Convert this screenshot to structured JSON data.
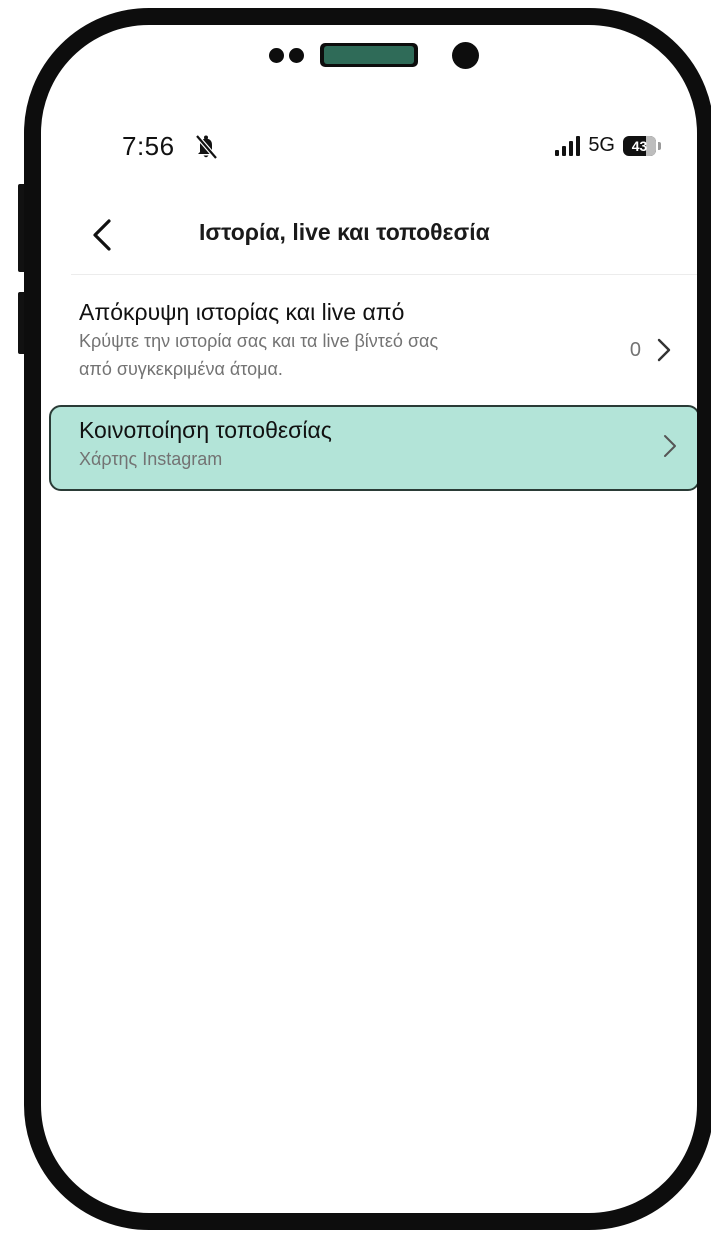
{
  "status_bar": {
    "time": "7:56",
    "network": "5G",
    "battery": "43"
  },
  "header": {
    "title": "Ιστορία, live και τοποθεσία"
  },
  "settings": [
    {
      "title": "Απόκρυψη ιστορίας και live από",
      "subtitle_line1": "Κρύψτε την ιστορία σας και τα live βίντεό σας",
      "subtitle_line2": "από συγκεκριμένα άτομα.",
      "count": "0"
    },
    {
      "title": "Κοινοποίηση τοποθεσίας",
      "subtitle_line1": "Χάρτης Instagram"
    }
  ],
  "colors": {
    "highlight_fill": "#b3e4d8",
    "highlight_border": "#2a3b36",
    "secondary_text": "#737373"
  }
}
